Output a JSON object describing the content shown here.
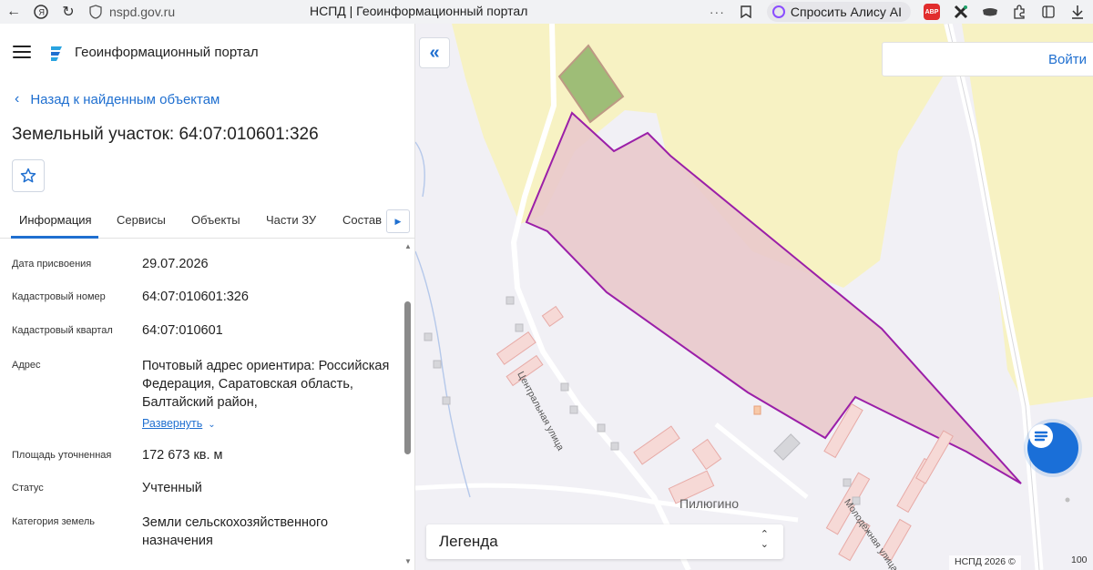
{
  "browser": {
    "url": "nspd.gov.ru",
    "tab_title": "НСПД | Геоинформационный портал",
    "more": "···",
    "alice_label": "Спросить Алису AI",
    "abp_label": "ABP"
  },
  "header": {
    "portal_title": "Геоинформационный портал"
  },
  "panel": {
    "back_label": "Назад к найденным объектам",
    "object_title": "Земельный участок: 64:07:010601:326",
    "tabs": [
      "Информация",
      "Сервисы",
      "Объекты",
      "Части ЗУ",
      "Состав"
    ],
    "rows": [
      {
        "label": "Дата присвоения",
        "value": "29.07.2026"
      },
      {
        "label": "Кадастровый номер",
        "value": "64:07:010601:326"
      },
      {
        "label": "Кадастровый квартал",
        "value": "64:07:010601"
      },
      {
        "label": "Адрес",
        "value": "Почтовый адрес ориентира: Российская Федерация, Саратовская область, Балтайский район,",
        "link": "Развернуть"
      },
      {
        "label": "Площадь уточненная",
        "value": "172 673 кв. м"
      },
      {
        "label": "Статус",
        "value": "Учтенный"
      },
      {
        "label": "Категория земель",
        "value": "Земли сельскохозяйственного назначения"
      }
    ]
  },
  "map": {
    "login_label": "Войти",
    "legend_label": "Легенда",
    "village_label": "Пилюгино",
    "street_central": "Центральная улица",
    "street_molodezh": "Молодёжная улица",
    "copyright": "НСПД 2026 ©",
    "scale": "100",
    "colors": {
      "parcel_fill": "#e9c9cc",
      "parcel_stroke": "#9b1fa8",
      "field": "#f7f2c3",
      "accent": "#1f6fd0"
    }
  }
}
